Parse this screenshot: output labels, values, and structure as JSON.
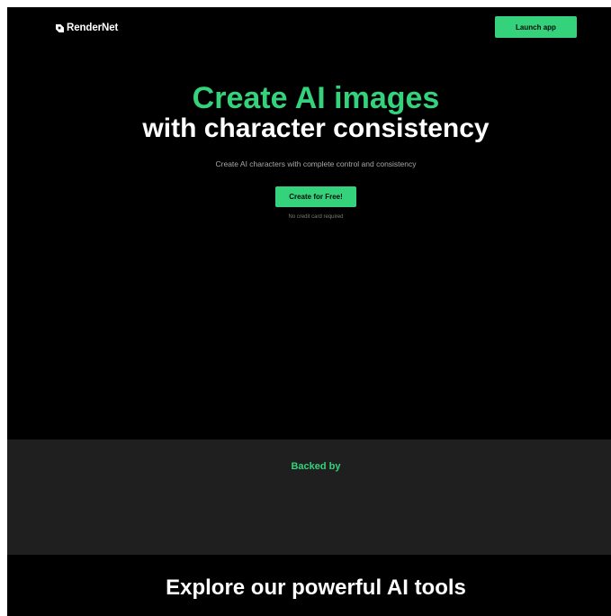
{
  "header": {
    "logo_text": "RenderNet",
    "launch_label": "Launch app"
  },
  "hero": {
    "title_line1": "Create AI images",
    "title_line2": "with character consistency",
    "subtitle": "Create AI characters with complete control and consistency",
    "cta_label": "Create for Free!",
    "cta_note": "No credit card required"
  },
  "backed": {
    "title": "Backed by"
  },
  "explore": {
    "title": "Explore our powerful AI tools"
  },
  "colors": {
    "accent": "#34d27b",
    "background": "#000000",
    "section": "#1f1f1f"
  }
}
